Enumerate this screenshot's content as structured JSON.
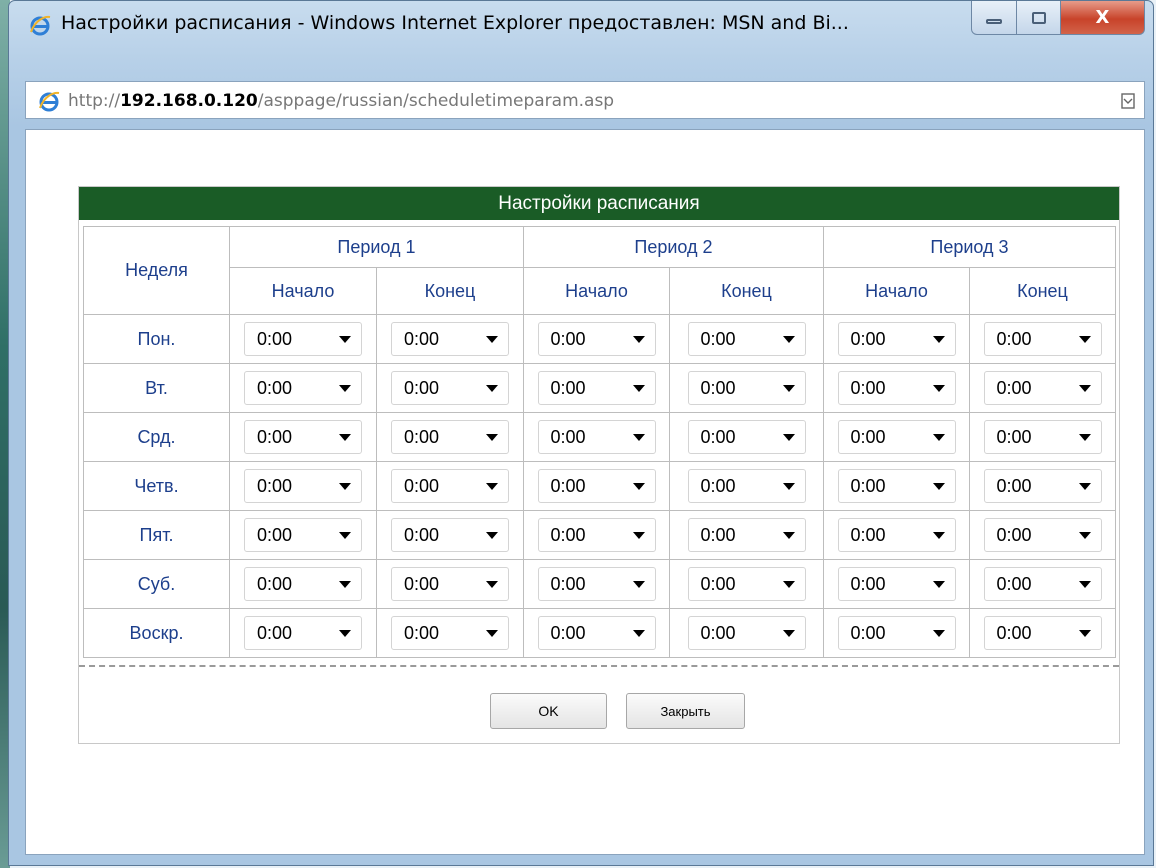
{
  "window": {
    "title": "Настройки расписания - Windows Internet Explorer предоставлен: MSN and Bi...",
    "close_glyph": "X"
  },
  "address": {
    "prefix": "http://",
    "host": "192.168.0.120",
    "path": "/asppage/russian/scheduletimeparam.asp"
  },
  "panel": {
    "title": "Настройки расписания",
    "week_label": "Неделя",
    "periods": [
      "Период 1",
      "Период 2",
      "Период 3"
    ],
    "start_label": "Начало",
    "end_label": "Конец"
  },
  "schedule": {
    "days": [
      {
        "label": "Пон.",
        "times": [
          "0:00",
          "0:00",
          "0:00",
          "0:00",
          "0:00",
          "0:00"
        ]
      },
      {
        "label": "Вт.",
        "times": [
          "0:00",
          "0:00",
          "0:00",
          "0:00",
          "0:00",
          "0:00"
        ]
      },
      {
        "label": "Срд.",
        "times": [
          "0:00",
          "0:00",
          "0:00",
          "0:00",
          "0:00",
          "0:00"
        ]
      },
      {
        "label": "Четв.",
        "times": [
          "0:00",
          "0:00",
          "0:00",
          "0:00",
          "0:00",
          "0:00"
        ]
      },
      {
        "label": "Пят.",
        "times": [
          "0:00",
          "0:00",
          "0:00",
          "0:00",
          "0:00",
          "0:00"
        ]
      },
      {
        "label": "Суб.",
        "times": [
          "0:00",
          "0:00",
          "0:00",
          "0:00",
          "0:00",
          "0:00"
        ]
      },
      {
        "label": "Воскр.",
        "times": [
          "0:00",
          "0:00",
          "0:00",
          "0:00",
          "0:00",
          "0:00"
        ]
      }
    ]
  },
  "buttons": {
    "ok": "OK",
    "close": "Закрыть"
  },
  "colors": {
    "header_green": "#1a5c26",
    "label_blue": "#1d3f8c"
  }
}
